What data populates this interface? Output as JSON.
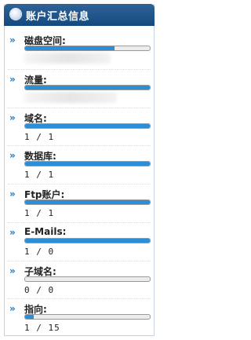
{
  "panel": {
    "title": "账户汇总信息",
    "items": [
      {
        "label": "磁盘空间:",
        "value": "",
        "fill": 0.72,
        "redacted": true
      },
      {
        "label": "流量:",
        "value": "",
        "fill": 1.0,
        "redacted": true
      },
      {
        "label": "域名:",
        "value": "1 / 1",
        "fill": 1.0
      },
      {
        "label": "数据库:",
        "value": "1 / 1",
        "fill": 1.0
      },
      {
        "label": "Ftp账户:",
        "value": "1 / 1",
        "fill": 1.0
      },
      {
        "label": "E-Mails:",
        "value": "1 / 0",
        "fill": 1.0
      },
      {
        "label": "子域名:",
        "value": "0 / 0",
        "fill": 0.0
      },
      {
        "label": "指向:",
        "value": "1 / 15",
        "fill": 0.067
      }
    ]
  },
  "colors": {
    "header_bg": "#1f5790",
    "bar_fill": "#2a8fd6",
    "arrow": "#1a78c2"
  },
  "icons": {
    "header": "info-dot-icon",
    "item_bullet": "double-chevron-right-icon"
  }
}
